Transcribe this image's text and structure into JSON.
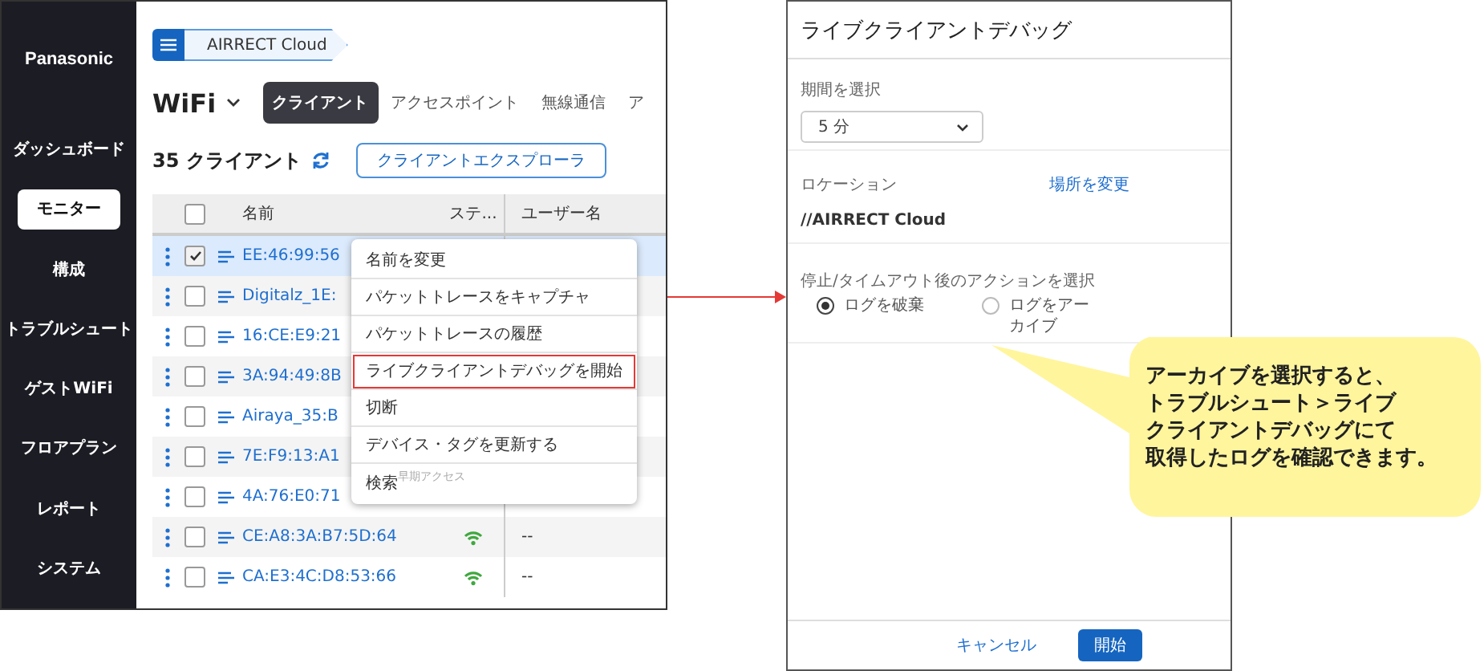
{
  "app": {
    "brand": "Panasonic",
    "sidebar": [
      {
        "label": "ダッシュボード",
        "selected": false
      },
      {
        "label": "モニター",
        "selected": true
      },
      {
        "label": "構成",
        "selected": false
      },
      {
        "label": "トラブルシュート",
        "selected": false
      },
      {
        "label": "ゲストWiFi",
        "selected": false
      },
      {
        "label": "フロアプラン",
        "selected": false
      },
      {
        "label": "レポート",
        "selected": false
      },
      {
        "label": "システム",
        "selected": false
      }
    ],
    "breadcrumb": "AIRRECT Cloud",
    "heading": "WiFi",
    "tabs": [
      {
        "label": "クライアント",
        "selected": true
      },
      {
        "label": "アクセスポイント",
        "selected": false
      },
      {
        "label": "無線通信",
        "selected": false
      },
      {
        "label": "ア",
        "selected": false
      }
    ],
    "count": "35 クライアント",
    "explorer_button": "クライアントエクスプローラ",
    "columns": [
      "名前",
      "ステ...",
      "ユーザー名"
    ],
    "all_checked": false,
    "rows": [
      {
        "name": "EE:46:99:56",
        "checked": true,
        "selected": true
      },
      {
        "name": "Digitalz_1E:",
        "checked": false,
        "selected": false
      },
      {
        "name": "16:CE:E9:21",
        "checked": false,
        "selected": false
      },
      {
        "name": "3A:94:49:8B",
        "checked": false,
        "selected": false
      },
      {
        "name": "Airaya_35:B",
        "checked": false,
        "selected": false
      },
      {
        "name": "7E:F9:13:A1",
        "checked": false,
        "selected": false
      },
      {
        "name": "4A:76:E0:71",
        "checked": false,
        "selected": false
      },
      {
        "name": "CE:A8:3A:B7:5D:64",
        "checked": false,
        "selected": false,
        "signal": true,
        "user": "--"
      },
      {
        "name": "CA:E3:4C:D8:53:66",
        "checked": false,
        "selected": false,
        "signal": true,
        "user": "--"
      }
    ],
    "context_menu": [
      {
        "label": "名前を変更",
        "highlighted": false
      },
      {
        "label": "パケットトレースをキャプチャ",
        "highlighted": false
      },
      {
        "label": "パケットトレースの履歴",
        "highlighted": false
      },
      {
        "label": "ライブクライアントデバッグを開始",
        "highlighted": true
      },
      {
        "label": "切断",
        "highlighted": false
      },
      {
        "label": "デバイス・タグを更新する",
        "highlighted": false
      },
      {
        "label": "検索",
        "highlighted": false,
        "badge": "早期アクセス"
      }
    ]
  },
  "dialog": {
    "title": "ライブクライアントデバッグ",
    "period_label": "期間を選択",
    "period_value": "5 分",
    "location_label": "ロケーション",
    "location_link": "場所を変更",
    "location_value": "//AIRRECT Cloud",
    "action_label": "停止/タイムアウト後のアクションを選択",
    "actions": [
      {
        "label": "ログを破棄",
        "selected": true
      },
      {
        "label": "ログをアーカイブ",
        "selected": false
      }
    ],
    "buttons": [
      {
        "label": "キャンセル",
        "kind": "link"
      },
      {
        "label": "開始",
        "kind": "primary"
      }
    ]
  },
  "callout": [
    "アーカイブを選択すると、",
    "トラブルシュート＞ライブ",
    "クライアントデバッグにて",
    "取得したログを確認できます。"
  ]
}
